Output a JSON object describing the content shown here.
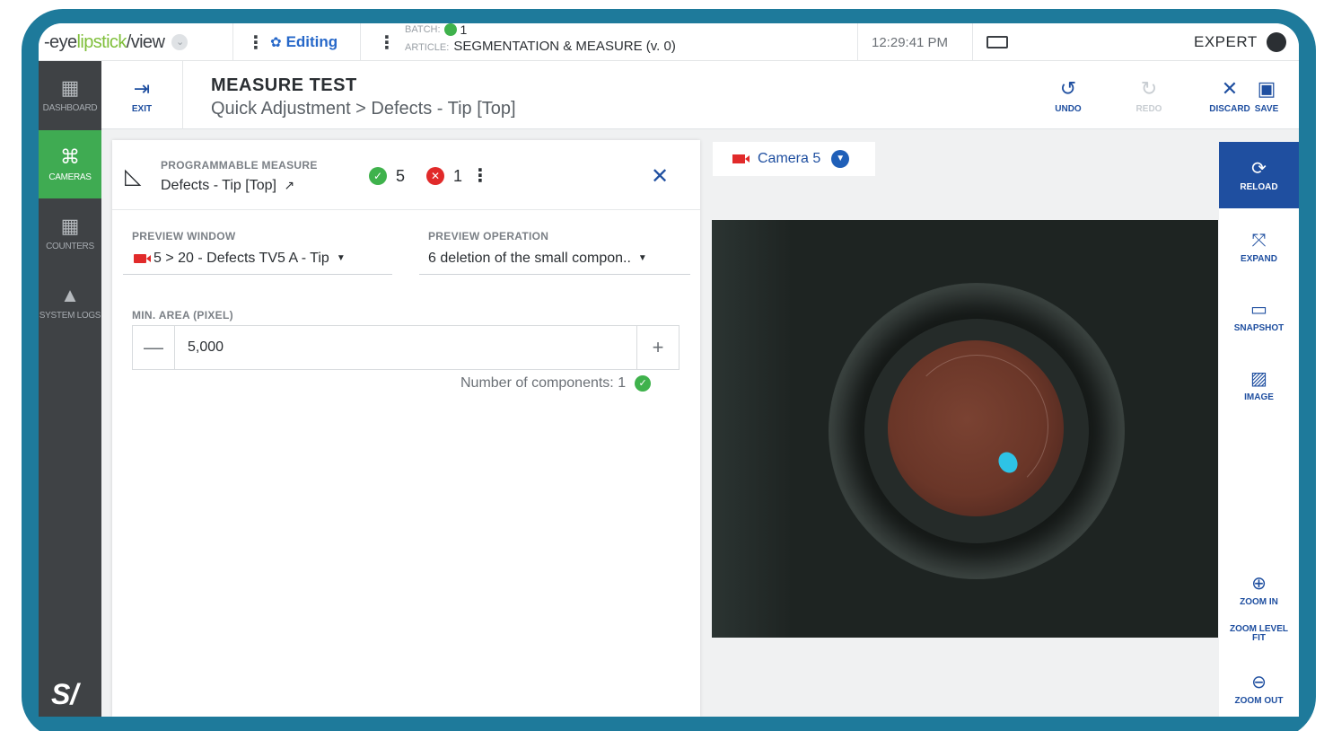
{
  "topbar": {
    "logo_prefix": "-eye ",
    "logo_green": "lipstick",
    "logo_suffix": "/view",
    "mode_label": "Editing",
    "batch_label": "BATCH:",
    "batch_value": "1",
    "article_label": "ARTICLE:",
    "article_value": "SEGMENTATION & MEASURE (v. 0)",
    "time": "12:29:41 PM",
    "user_level": "EXPERT"
  },
  "sidebar": {
    "items": [
      {
        "label": "DASHBOARD",
        "icon": "dashboard-icon",
        "active": false
      },
      {
        "label": "CAMERAS",
        "icon": "camera-icon",
        "active": true
      },
      {
        "label": "COUNTERS",
        "icon": "counters-icon",
        "active": false
      },
      {
        "label": "SYSTEM LOGS",
        "icon": "warning-icon",
        "active": false
      }
    ]
  },
  "header": {
    "exit_label": "EXIT",
    "title": "MEASURE TEST",
    "breadcrumb": "Quick Adjustment > Defects - Tip [Top]",
    "undo_label": "UNDO",
    "redo_label": "REDO",
    "discard_label": "DISCARD",
    "save_label": "SAVE"
  },
  "panel": {
    "type_label": "PROGRAMMABLE MEASURE",
    "name": "Defects - Tip [Top]",
    "ok_count": "5",
    "ko_count": "1",
    "preview_window_label": "PREVIEW WINDOW",
    "preview_window_value": "5 > 20 - Defects TV5 A - Tip",
    "preview_operation_label": "PREVIEW OPERATION",
    "preview_operation_value": "6 deletion of the small compon..",
    "min_area_label": "MIN. AREA (PIXEL)",
    "min_area_value": "5,000",
    "components_text": "Number of components: 1"
  },
  "camera": {
    "name": "Camera 5"
  },
  "tools": {
    "reload": "RELOAD",
    "expand": "EXPAND",
    "snapshot": "SNAPSHOT",
    "image": "IMAGE",
    "zoom_in": "ZOOM IN",
    "zoom_fit": "ZOOM LEVEL FIT",
    "zoom_out": "ZOOM OUT"
  },
  "colors": {
    "frame": "#1e7a9b",
    "accent_blue": "#1f4fa0",
    "active_green": "#3fab52",
    "ok_green": "#3fb24c",
    "error_red": "#e12a2a",
    "defect_cyan": "#2ec3e6"
  }
}
